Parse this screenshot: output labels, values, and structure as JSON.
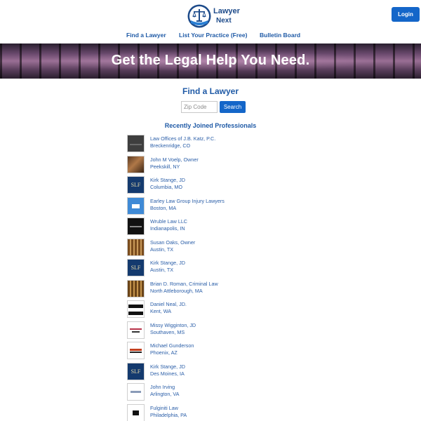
{
  "header": {
    "logo_line1": "Lawyer",
    "logo_line2": "Next",
    "login_label": "Login"
  },
  "nav": {
    "items": [
      {
        "label": "Find a Lawyer"
      },
      {
        "label": "List Your Practice (Free)"
      },
      {
        "label": "Bulletin Board"
      }
    ]
  },
  "hero": {
    "title": "Get the Legal Help You Need."
  },
  "finder": {
    "title": "Find a Lawyer",
    "zip_placeholder": "Zip Code",
    "search_label": "Search"
  },
  "recent": {
    "title": "Recently Joined Professionals",
    "items": [
      {
        "name": "Law Offices of J.B. Katz, P.C.",
        "location": "Breckenridge, CO"
      },
      {
        "name": "John M Voelp, Owner",
        "location": "Peekskill, NY"
      },
      {
        "name": "Kirk Stange, JD",
        "location": "Columbia, MO"
      },
      {
        "name": "Earley Law Group Injury Lawyers",
        "location": "Boston, MA"
      },
      {
        "name": "Wruble Law LLC",
        "location": "Indianapolis, IN"
      },
      {
        "name": "Susan Oaks, Owner",
        "location": "Austin, TX"
      },
      {
        "name": "Kirk Stange, JD",
        "location": "Austin, TX"
      },
      {
        "name": "Brian D. Roman, Criminal Law",
        "location": "North Attleborough, MA"
      },
      {
        "name": "Daniel Neal, JD.",
        "location": "Kent, WA"
      },
      {
        "name": "Missy Wigginton, JD",
        "location": "Southaven, MS"
      },
      {
        "name": "Michael Gunderson",
        "location": "Phoenix, AZ"
      },
      {
        "name": "Kirk Stange, JD",
        "location": "Des Moines, IA"
      },
      {
        "name": "John Irving",
        "location": "Arlington, VA"
      },
      {
        "name": "Fulginiti Law",
        "location": "Philadelphia, PA"
      }
    ]
  },
  "colors": {
    "accent": "#1466c9",
    "link": "#1f5aa6"
  }
}
